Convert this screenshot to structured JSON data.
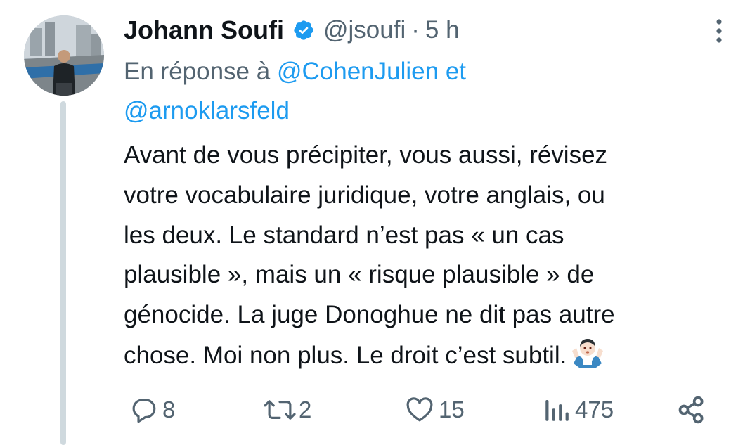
{
  "tweet": {
    "display_name": "Johann Soufi",
    "handle": "@jsoufi",
    "separator": "·",
    "time": "5 h",
    "reply_prefix": "En réponse à",
    "reply_mention_1": "@CohenJulien",
    "reply_connector": "et",
    "reply_mention_2": "@arnoklarsfeld",
    "text": "Avant de vous précipiter, vous aussi, révisez\nvotre vocabulaire juridique, votre anglais, ou\nles deux. Le standard n’est pas « un cas\nplausible », mais un « risque plausible » de\ngénocide. La juge Donoghue ne dit pas autre\nchose. Moi non plus. Le droit c’est subtil.",
    "emoji": "man-shrugging-emoji"
  },
  "actions": {
    "replies": "8",
    "retweets": "2",
    "likes": "15",
    "views": "475"
  },
  "icons": [
    "verified-badge-icon",
    "more-options-icon",
    "reply-icon",
    "retweet-icon",
    "like-icon",
    "views-icon",
    "share-icon"
  ],
  "colors": {
    "accent": "#1d9bf0",
    "text_primary": "#0f1419",
    "text_secondary": "#536471",
    "thread_line": "#cfd9de"
  }
}
